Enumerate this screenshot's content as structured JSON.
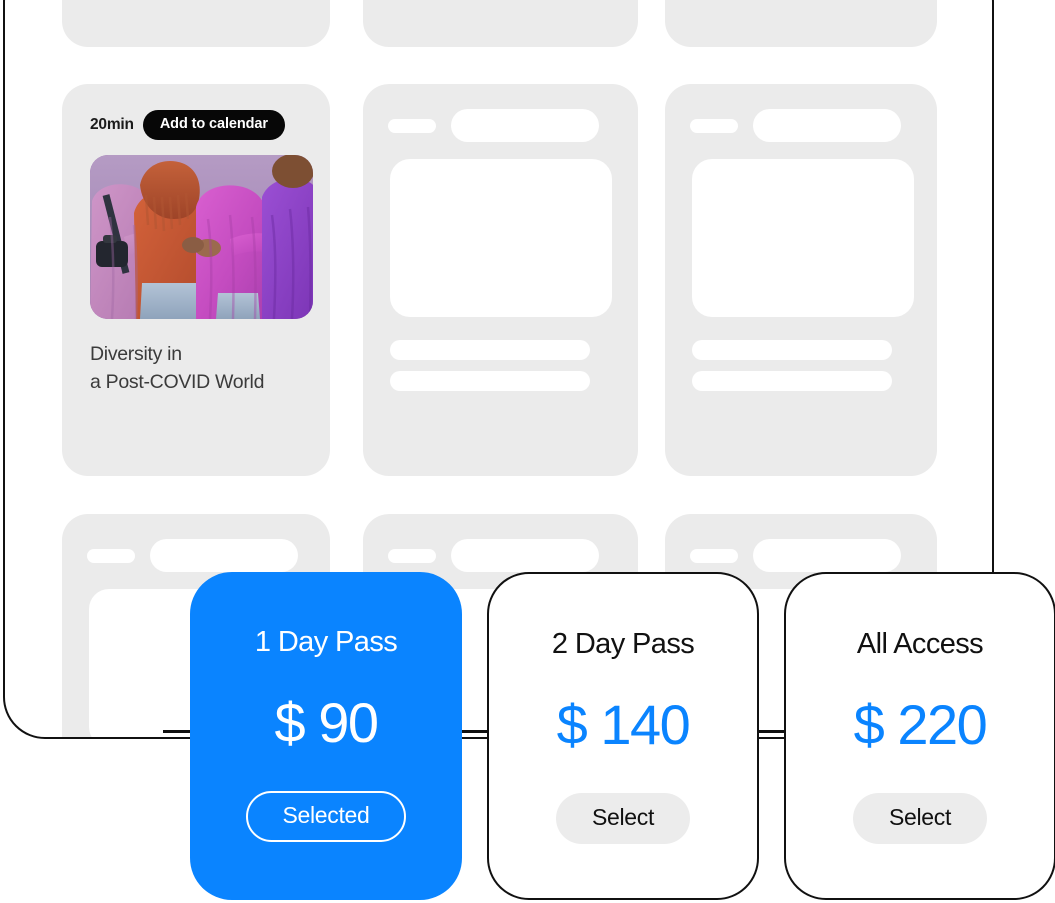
{
  "window": {
    "name": "event-listing-window"
  },
  "event_card": {
    "duration": "20min",
    "add_to_calendar_label": "Add to calendar",
    "photo_alt": "group-hug-photo",
    "title_line1": "Diversity in",
    "title_line2": "a Post-COVID World"
  },
  "pricing": {
    "cards": [
      {
        "plan": "1 Day Pass",
        "price": "$ 90",
        "button_label": "Selected",
        "selected": true
      },
      {
        "plan": "2 Day Pass",
        "price": "$ 140",
        "button_label": "Select",
        "selected": false
      },
      {
        "plan": "All Access",
        "price": "$ 220",
        "button_label": "Select",
        "selected": false
      }
    ]
  },
  "colors": {
    "accent_blue": "#0a84ff",
    "skeleton_gray": "#ebebeb",
    "pill_black": "#070707",
    "button_gray": "#ececec",
    "outline_black": "#111111",
    "title_text": "#3b3b3b"
  }
}
